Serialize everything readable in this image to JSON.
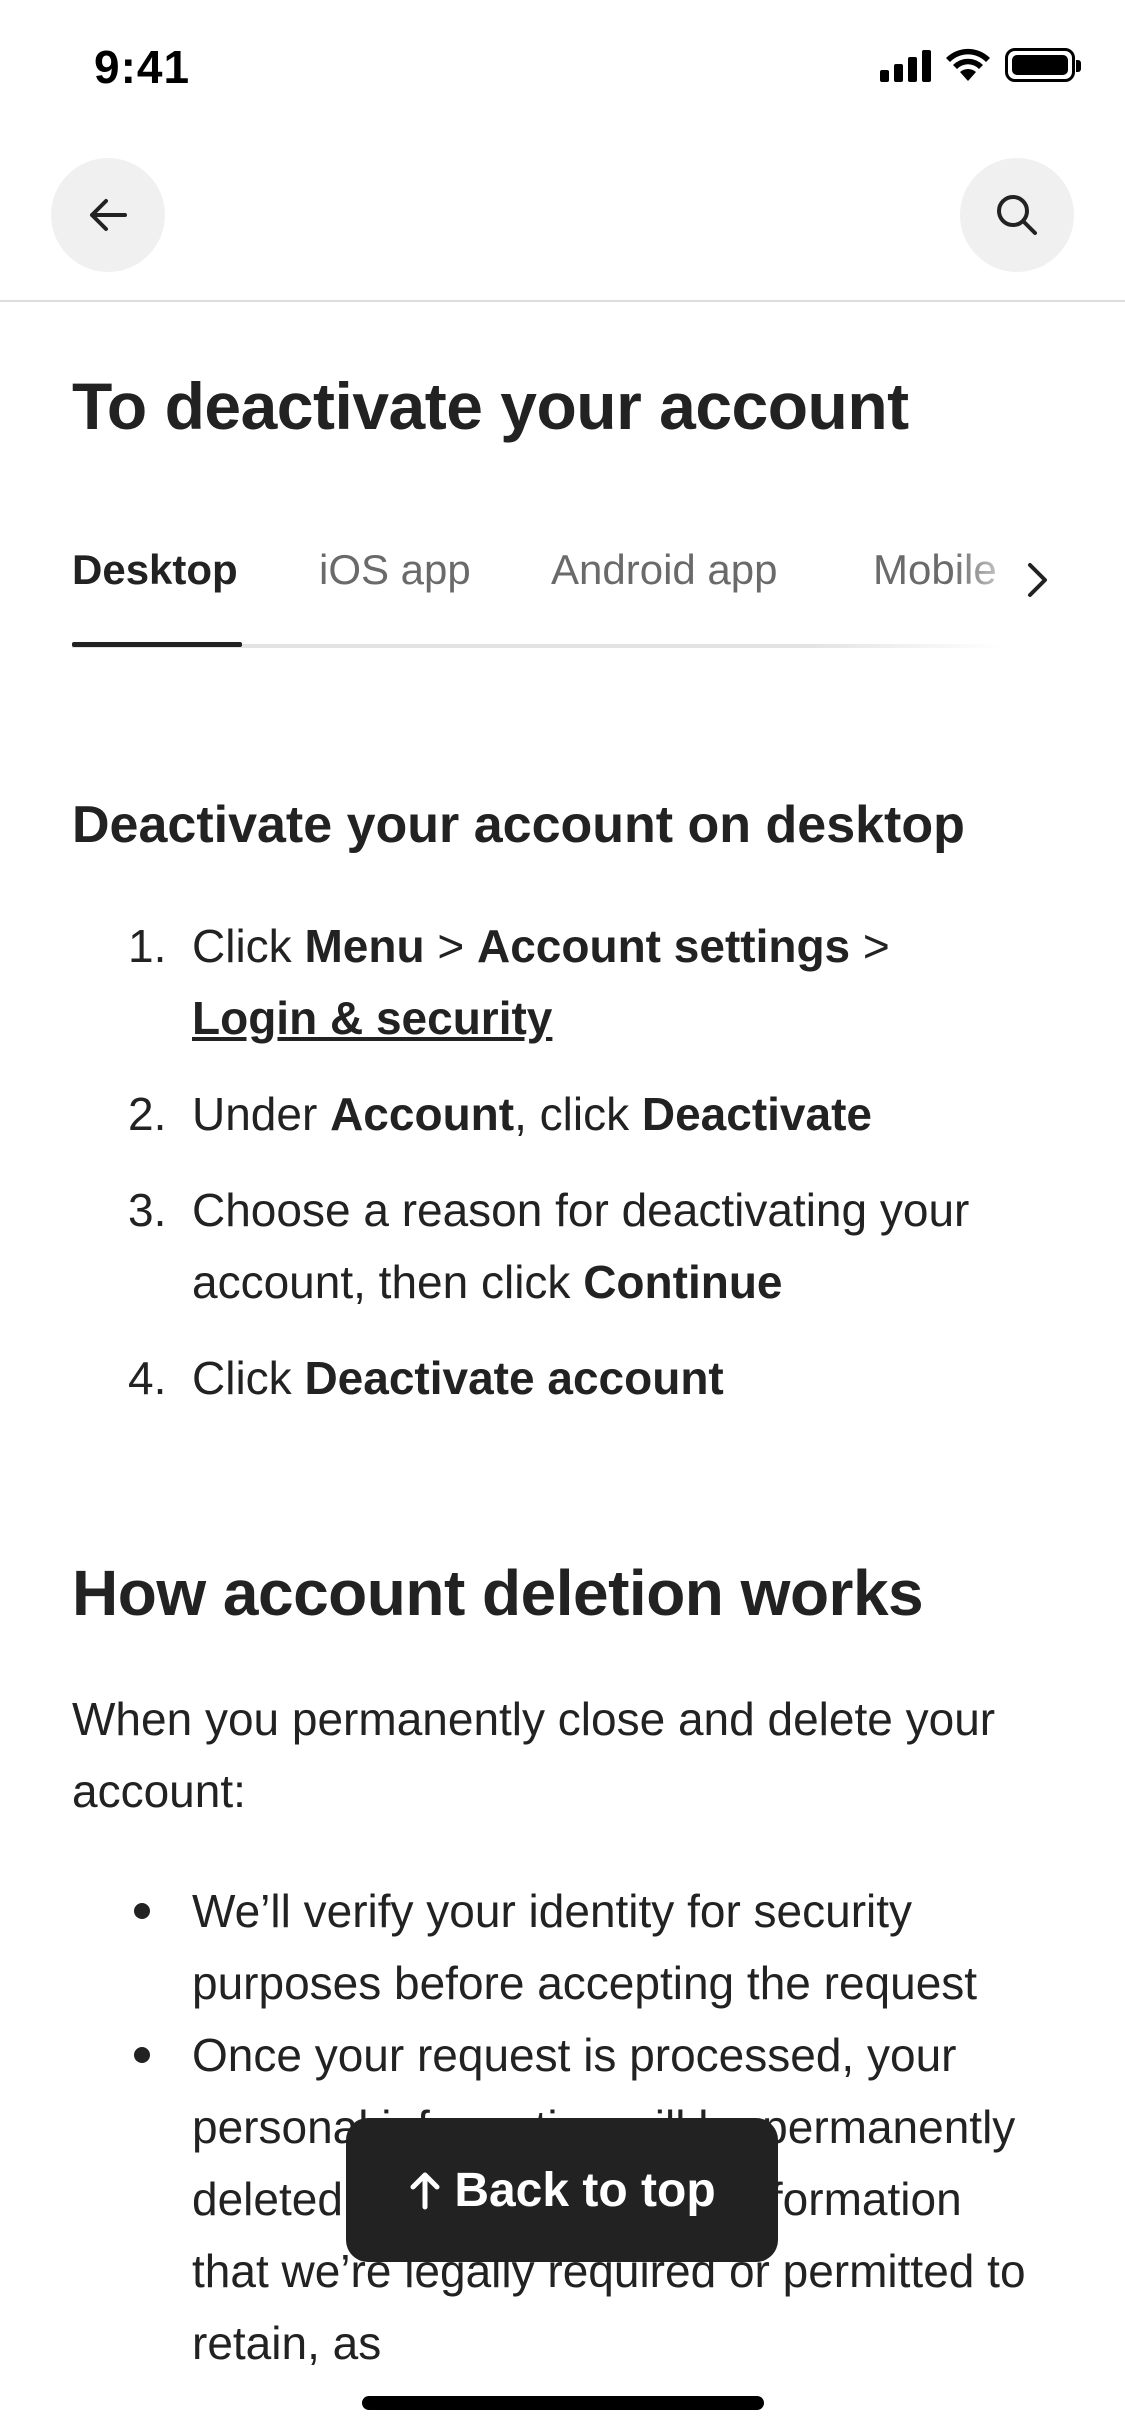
{
  "status_bar": {
    "time": "9:41"
  },
  "header": {
    "back_icon": "arrow-left-icon",
    "search_icon": "search-icon"
  },
  "page": {
    "title": "To deactivate your account"
  },
  "tabs": [
    {
      "label": "Desktop",
      "active": true
    },
    {
      "label": "iOS app",
      "active": false
    },
    {
      "label": "Android app",
      "active": false
    },
    {
      "label": "Mobile",
      "active": false
    }
  ],
  "desktop_section": {
    "heading": "Deactivate your account on desktop",
    "steps": [
      {
        "number": "1.",
        "parts": [
          "Click ",
          "Menu",
          " > ",
          "Account settings",
          " >",
          "Login & security"
        ]
      },
      {
        "number": "2.",
        "parts": [
          "Under ",
          "Account",
          ", click ",
          "Deactivate"
        ]
      },
      {
        "number": "3.",
        "parts": [
          "Choose a reason for deactivating your account, then click ",
          "Continue"
        ]
      },
      {
        "number": "4.",
        "parts": [
          "Click ",
          "Deactivate account"
        ]
      }
    ]
  },
  "deletion_section": {
    "heading": "How account deletion works",
    "intro": "When you permanently close and delete your account:",
    "bullets": [
      "We’ll verify your identity for security purposes before accepting the request",
      "Once your request is processed, your personal information will be permanently deleted, except for certain information that we’re legally required or permitted to retain, as"
    ]
  },
  "floating_button": {
    "label": "Back to top"
  },
  "colors": {
    "text": "#222222",
    "secondary_text": "#6a6a6a",
    "button_bg": "#222222",
    "divider": "#dddddd"
  }
}
